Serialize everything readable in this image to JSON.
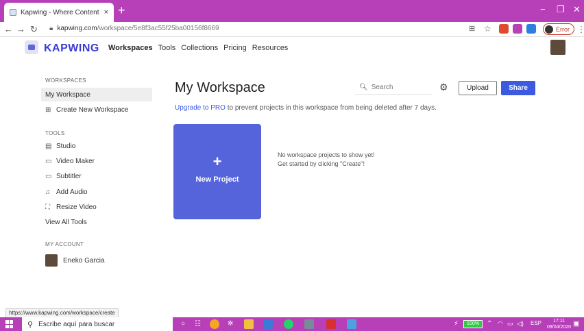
{
  "browser": {
    "tab_title": "Kapwing - Where Content Creati",
    "tab_close": "×",
    "new_tab": "+",
    "minimize": "−",
    "restore": "❐",
    "close": "✕",
    "url_domain": "kapwing.com",
    "url_path": "/workspace/5e8f3ac55f25ba00156f8669",
    "profile_status": "Error",
    "status_url": "https://www.kapwing.com/workspace/create"
  },
  "app": {
    "logo_text": "KAPWING",
    "nav": [
      "Workspaces",
      "Tools",
      "Collections",
      "Pricing",
      "Resources"
    ]
  },
  "sidebar": {
    "workspaces_label": "WORKSPACES",
    "my_workspace": "My Workspace",
    "create_workspace": "Create New Workspace",
    "tools_label": "TOOLS",
    "tools": [
      "Studio",
      "Video Maker",
      "Subtitler",
      "Add Audio",
      "Resize Video"
    ],
    "view_all": "View All Tools",
    "account_label": "MY ACCOUNT",
    "user_name": "Eneko Garcia"
  },
  "main": {
    "title": "My Workspace",
    "search_placeholder": "Search",
    "upload_label": "Upload",
    "share_label": "Share",
    "upgrade_link": "Upgrade to PRO",
    "upgrade_text": " to prevent projects in this workspace from being deleted after 7 days.",
    "new_project_plus": "+",
    "new_project_label": "New Project",
    "empty_line1": "No workspace projects to show yet!",
    "empty_line2": "Get started by clicking \"Create\"!"
  },
  "taskbar": {
    "search_text": "Escribe aquí para buscar",
    "battery": "100%",
    "lang": "ESP",
    "time": "17:11",
    "date": "09/04/2020"
  },
  "colors": {
    "accent": "#3c5ae0",
    "titlebar": "#b73fb8",
    "new_project_bg": "#5564db"
  }
}
